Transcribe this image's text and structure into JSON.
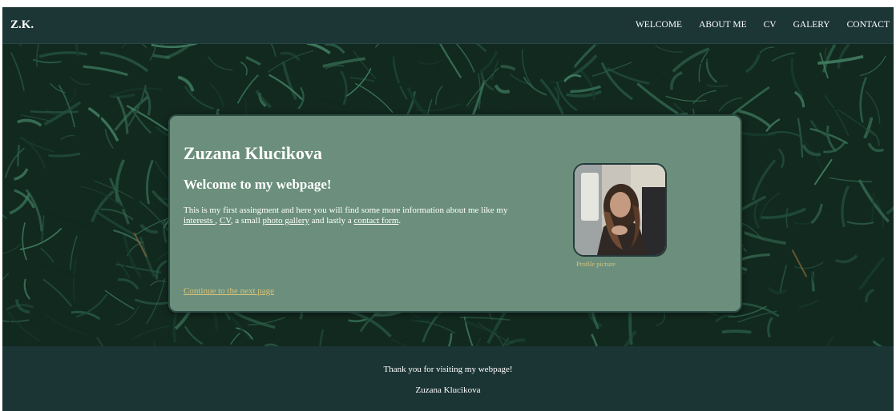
{
  "nav": {
    "brand": "Z.K.",
    "links": [
      {
        "label": "WELCOME"
      },
      {
        "label": "ABOUT ME"
      },
      {
        "label": "CV"
      },
      {
        "label": "GALERY"
      },
      {
        "label": "CONTACT"
      }
    ]
  },
  "hero": {
    "name": "Zuzana Klucikova",
    "welcome": "Welcome to my webpage!",
    "intro_text_1": "This is my first assingment and here you will find some more information about me like my ",
    "link_interests": "interests ",
    "intro_sep_1": ", ",
    "link_cv": "CV",
    "intro_sep_2": ", a small ",
    "link_gallery": "photo gallery",
    "intro_sep_3": " and lastly a ",
    "link_contact": "contact form",
    "intro_end": ".",
    "profile_caption": "Profile picture",
    "continue_link": "Continue to the next page"
  },
  "footer": {
    "thanks": "Thank you for visiting my webpage!",
    "name": "Zuzana Klucikova"
  },
  "colors": {
    "navbar": "#1c3535",
    "card": "#6b8f7c",
    "footer": "#1b3434",
    "accent_link": "#d8c27a"
  }
}
